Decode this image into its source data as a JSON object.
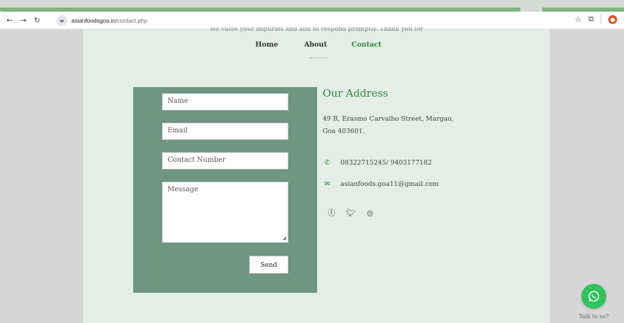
{
  "browser": {
    "url_domain": "asianfoodsgoa.in",
    "url_path": "/contact.php",
    "icons": [
      "back-icon",
      "forward-icon",
      "reload-icon",
      "site-settings-icon",
      "bookmark-star-icon",
      "extensions-icon",
      "profile-icon"
    ]
  },
  "header": {
    "tagline_cut": "We value your inquiries and aim to respond promptly. Thank you for",
    "nav": [
      {
        "label": "Home"
      },
      {
        "label": "About"
      },
      {
        "label": "Contact",
        "active": true
      }
    ]
  },
  "form": {
    "name_placeholder": "Name",
    "email_placeholder": "Email",
    "phone_placeholder": "Contact Number",
    "message_placeholder": "Message",
    "send_label": "Send"
  },
  "address": {
    "title": "Our Address",
    "line1": "49 B, Erasmo Carvalho Street, Margao,",
    "line2": "Goa 403601.",
    "phone": "08322715245/ 9403177182",
    "email": "asianfoods.goa11@gmail.com",
    "socials": [
      "facebook-icon",
      "twitter-icon",
      "instagram-icon"
    ]
  },
  "widget": {
    "label": "Talk to us?"
  },
  "colors": {
    "accent_green": "#2a8a3a",
    "panel": "#6f9583",
    "page_bg": "#e4ede6",
    "whatsapp": "#2ec45b"
  }
}
